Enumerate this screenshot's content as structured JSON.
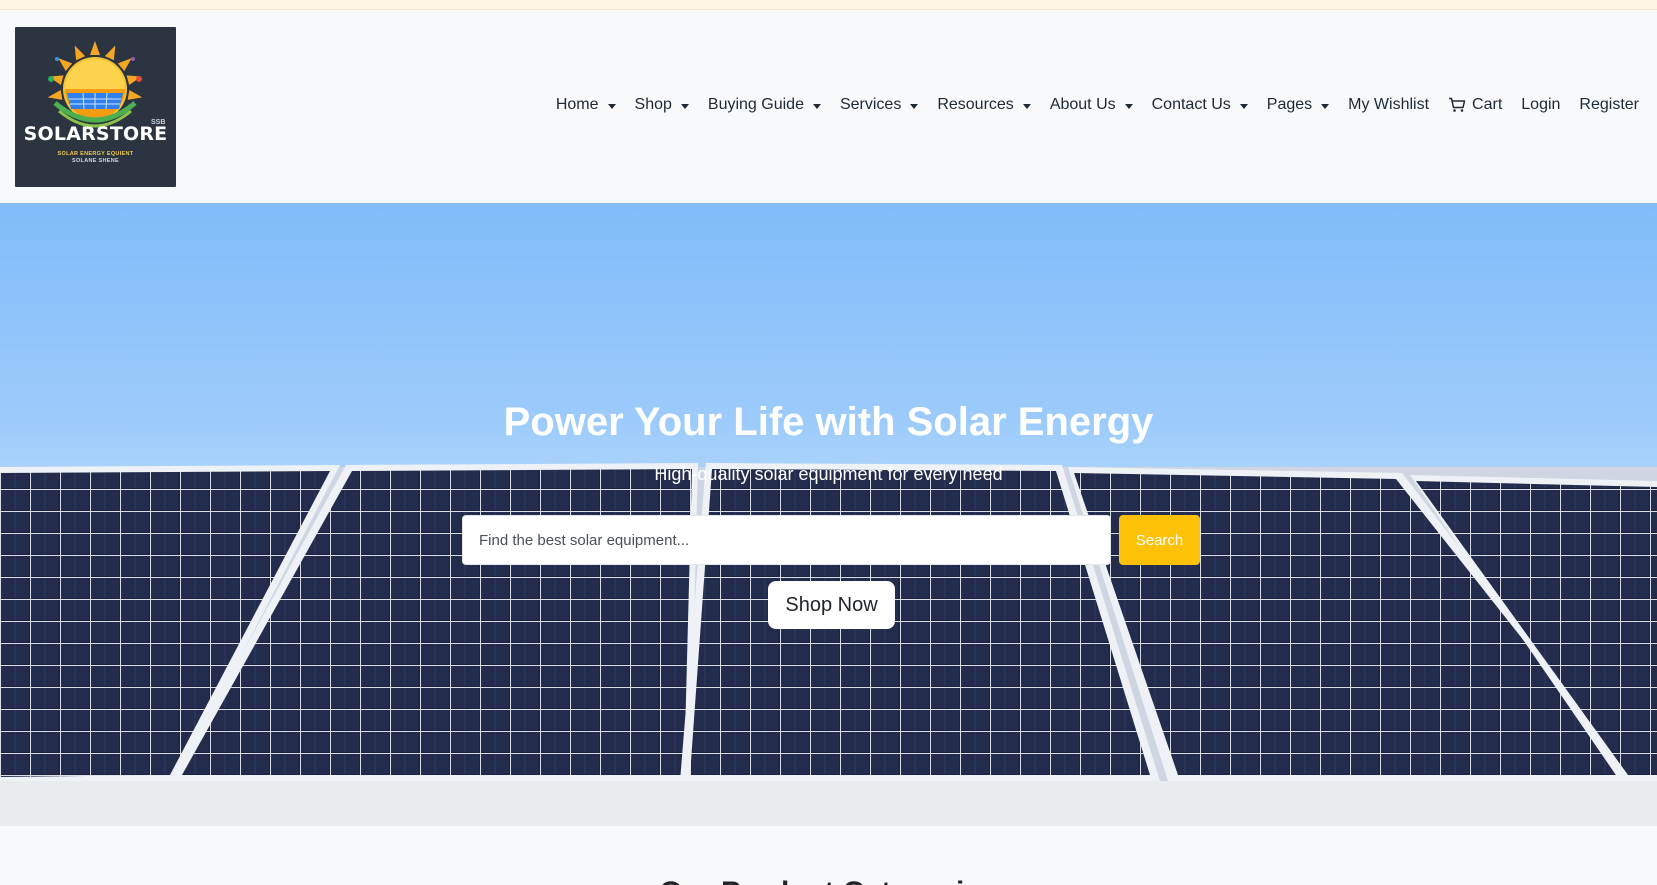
{
  "brand": {
    "name": "SOLARSTORE",
    "tag": "SSB",
    "line1": "SOLAR ENERGY EQUIENT",
    "line2": "SOLANE SHENE"
  },
  "nav": {
    "home": "Home",
    "shop": "Shop",
    "buying_guide": "Buying Guide",
    "services": "Services",
    "resources": "Resources",
    "about": "About Us",
    "contact": "Contact Us",
    "pages": "Pages",
    "wishlist": "My Wishlist",
    "cart": "Cart",
    "login": "Login",
    "register": "Register"
  },
  "hero": {
    "title": "Power Your Life with Solar Energy",
    "subtitle": "High-quality solar equipment for every need",
    "search_placeholder": "Find the best solar equipment...",
    "search_label": "Search",
    "shop_label": "Shop Now"
  },
  "section": {
    "title": "Our Product Categories"
  },
  "colors": {
    "accent": "#ffc107",
    "sky": "#80bcf8",
    "panel": "#1c2340"
  }
}
